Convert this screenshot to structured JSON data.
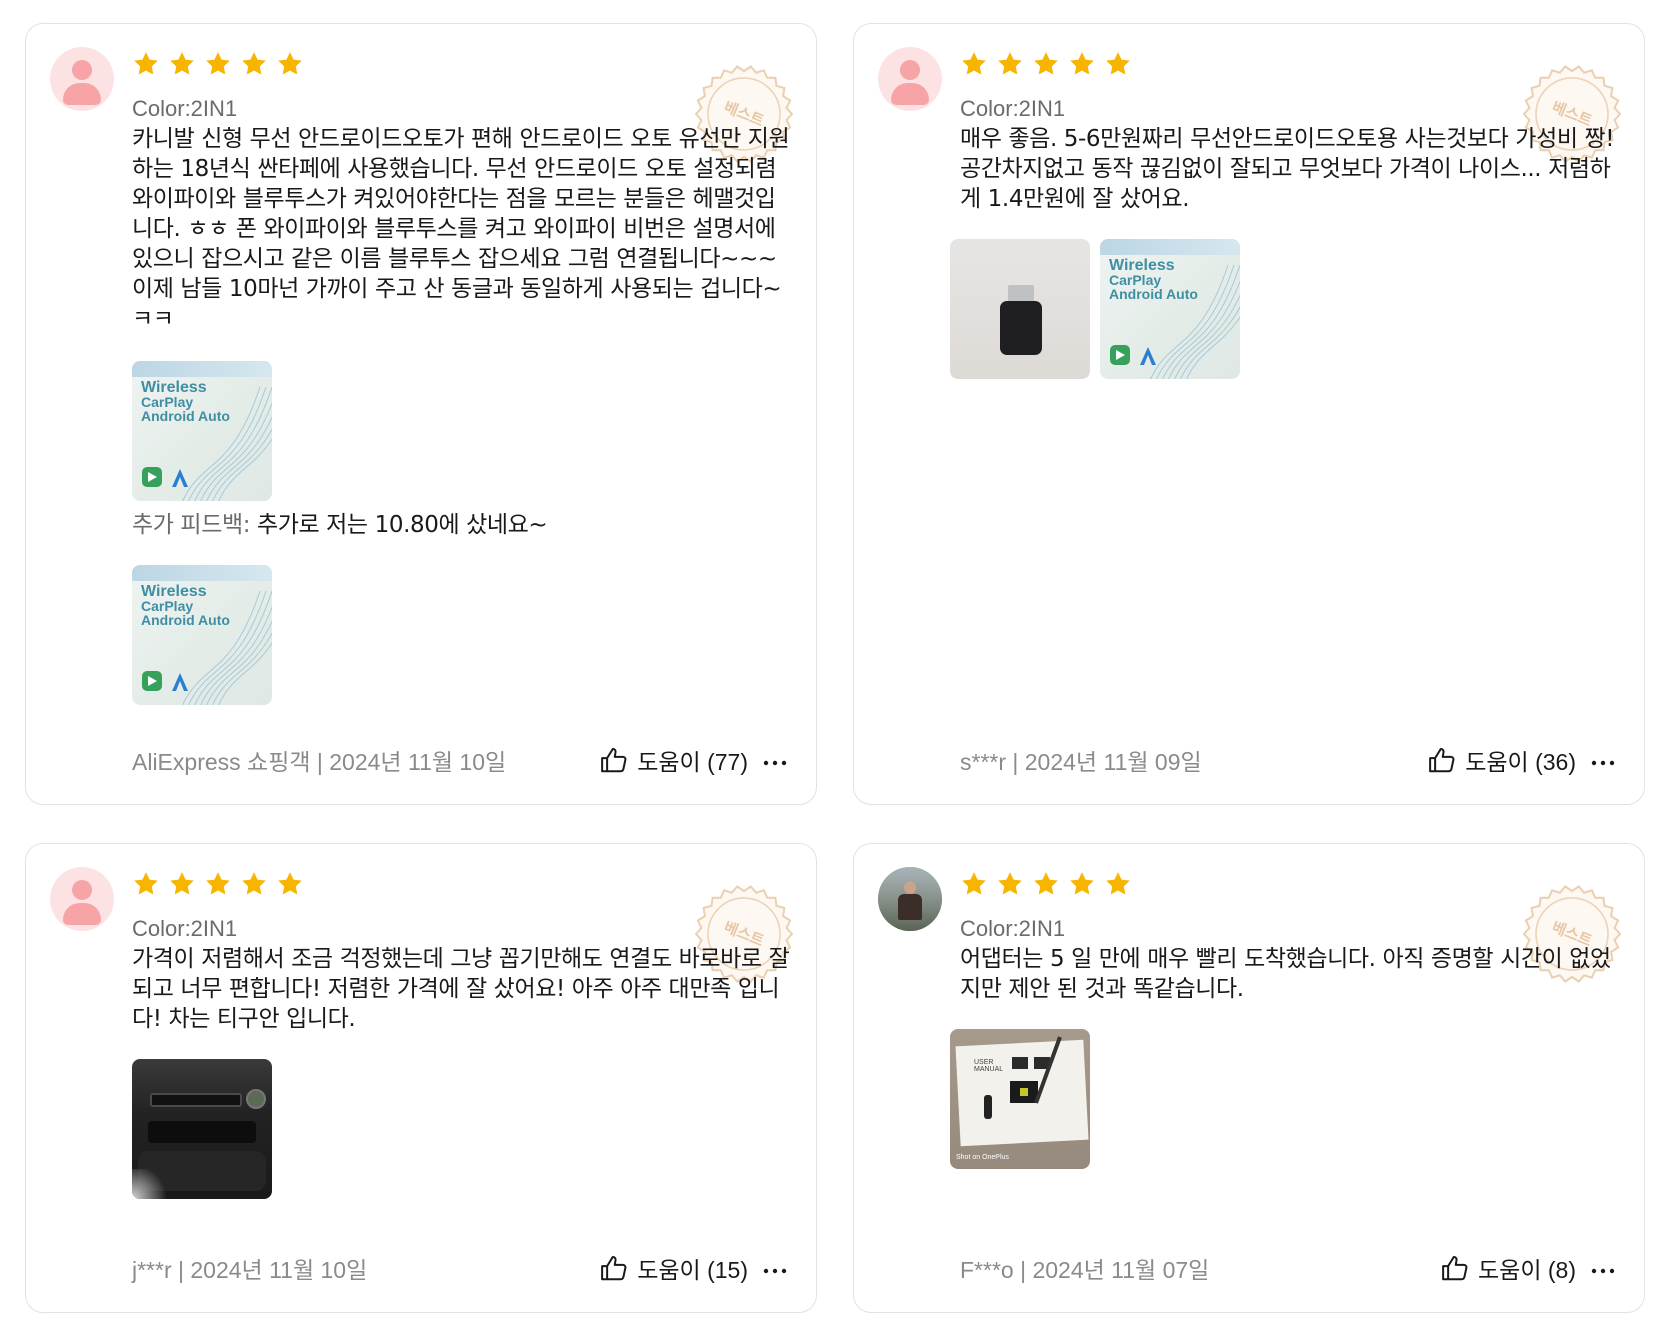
{
  "colors": {
    "star": "#f7b500",
    "seal": "#e8c7a4",
    "avatar_bg": "#fde2e3",
    "avatar_fg": "#f7a4a7"
  },
  "reviews": [
    {
      "rating": 5,
      "variant": "Color:2IN1",
      "badge": "베스트",
      "text": "카니발 신형 무선 안드로이드오토가 편해 안드로이드 오토 유선만 지원하는 18년식 싼타페에 사용했습니다. 무선 안드로이드 오토 설정되렴 와이파이와 블루투스가 켜있어야한다는 점을 모르는 분들은 헤맬것입니다. ㅎㅎ 폰 와이파이와 블루투스를 켜고 와이파이 비번은 설명서에 있으니 잡으시고 같은 이름 블루투스 잡으세요 그럼 연결됩니다~~~ 이제 남들 10마넌 가까이 주고 산 동글과 동일하게 사용되는 겁니다~ ㅋㅋ",
      "feedback_label": "추가 피드백:",
      "feedback_text": "추가로 저는 10.80에 샀네요~",
      "box_text": [
        "Wireless",
        "CarPlay",
        "Android Auto"
      ],
      "meta": "AliExpress 쇼핑객 | 2024년 11월 10일",
      "helpful": "도움이 (77)"
    },
    {
      "rating": 5,
      "variant": "Color:2IN1",
      "badge": "베스트",
      "text": "매우 좋음. 5-6만원짜리 무선안드로이드오토용 사는것보다 가성비 짱! 공간차지없고 동작 끊김없이 잘되고 무엇보다 가격이 나이스... 저렴하게 1.4만원에 잘 샀어요.",
      "box_text": [
        "Wireless",
        "CarPlay",
        "Android Auto"
      ],
      "meta": "s***r | 2024년 11월 09일",
      "helpful": "도움이 (36)"
    },
    {
      "rating": 5,
      "variant": "Color:2IN1",
      "badge": "베스트",
      "text": "가격이 저렴해서 조금 걱정했는데 그냥 꼽기만해도 연결도 바로바로 잘 되고 너무 편합니다! 저렴한 가격에 잘 샀어요! 아주 아주 대만족 입니다! 차는 티구안 입니다.",
      "meta": "j***r | 2024년 11월 10일",
      "helpful": "도움이 (15)"
    },
    {
      "rating": 5,
      "variant": "Color:2IN1",
      "badge": "베스트",
      "text": "어댑터는 5 일 만에 매우 빨리 도착했습니다. 아직 증명할 시간이 없었지만 제안 된 것과 똑같습니다.",
      "photo_text": [
        "USER",
        "MANUAL",
        "Shot on OnePlus"
      ],
      "meta": "F***o | 2024년 11월 07일",
      "helpful": "도움이 (8)"
    }
  ]
}
